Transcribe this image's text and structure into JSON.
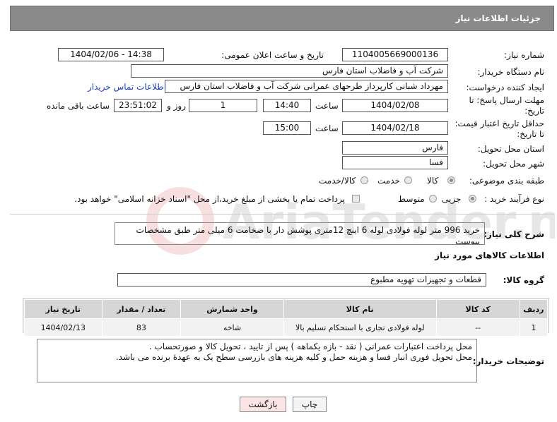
{
  "header": {
    "title": "جزئیات اطلاعات نیاز"
  },
  "fields": {
    "need_number_label": "شماره نیاز:",
    "need_number": "1104005669000136",
    "announce_label": "تاریخ و ساعت اعلان عمومی:",
    "announce_value": "1404/02/06 - 14:38",
    "buyer_org_label": "نام دستگاه خریدار:",
    "buyer_org": "شرکت آب و فاضلاب استان فارس",
    "requester_label": "ایجاد کننده درخواست:",
    "requester": "مهرداد شبانی کارپرداز طرحهای عمرانی  شرکت آب و فاضلاب استان فارس",
    "contact_link": "اطلاعات تماس خریدار",
    "deadline_label_1": "مهلت ارسال پاسخ: تا",
    "deadline_label_2": "تاریخ:",
    "deadline_date": "1404/02/08",
    "time_label": "ساعت",
    "deadline_time": "14:40",
    "days_value": "1",
    "days_label": "روز و",
    "remaining_value": "23:51:02",
    "remaining_label": "ساعت باقی مانده",
    "min_price_label_1": "حداقل تاریخ اعتبار قیمت:",
    "min_price_label_2": "تا تاریخ:",
    "min_price_date": "1404/02/18",
    "min_price_time": "15:00",
    "province_label": "استان محل تحویل:",
    "province": "فارس",
    "city_label": "شهر محل تحویل:",
    "city": "فسا",
    "category_label": "طبقه بندی موضوعی:",
    "category_options": [
      "کالا",
      "خدمت",
      "کالا/خدمت"
    ],
    "process_label": "نوع فرآیند خرید :",
    "process_options": [
      "جزیی",
      "متوسط"
    ],
    "payment_note": "پرداخت تمام یا بخشی از مبلغ خرید،از محل \"اسناد خزانه اسلامی\" خواهد بود."
  },
  "summary": {
    "label": "شرح کلی نیاز:",
    "text": "خرید 996 متر لوله فولادی لوله 6 اینچ 12متری  پوشش دار با ضخامت 6 میلی متر طبق مشخصات پیوست"
  },
  "goods": {
    "section_title": "اطلاعات کالاهای مورد نیاز",
    "group_label": "گروه کالا:",
    "group_value": "قطعات و تجهیزات تهویه مطبوع",
    "columns": [
      "ردیف",
      "کد کالا",
      "نام کالا",
      "واحد شمارش",
      "تعداد / مقدار",
      "تاریخ نیاز"
    ],
    "rows": [
      [
        "1",
        "--",
        "لوله فولادی تجاری با استحکام تسلیم بالا",
        "شاخه",
        "83",
        "1404/02/13"
      ]
    ]
  },
  "buyer_notes": {
    "label": "توضیحات خریدار:",
    "lines": [
      "محل پرداخت اعتبارات عمرانی ( نقد - بازه یکماهه ) پس از تایید ، تحویل کالا و صورتحساب .",
      "محل تحویل فوری انبار فسا  و هزینه حمل و کلیه هزینه های بازرسی سطح یک به عهدۀ برنده می باشد."
    ]
  },
  "buttons": {
    "print": "چاپ",
    "back": "بازگشت"
  },
  "watermark_text": "AriaTender.neT",
  "colors": {
    "header_bg": "#8a8a8a",
    "link": "#1a3fbf",
    "back_button_bg": "#fbe4e4"
  }
}
